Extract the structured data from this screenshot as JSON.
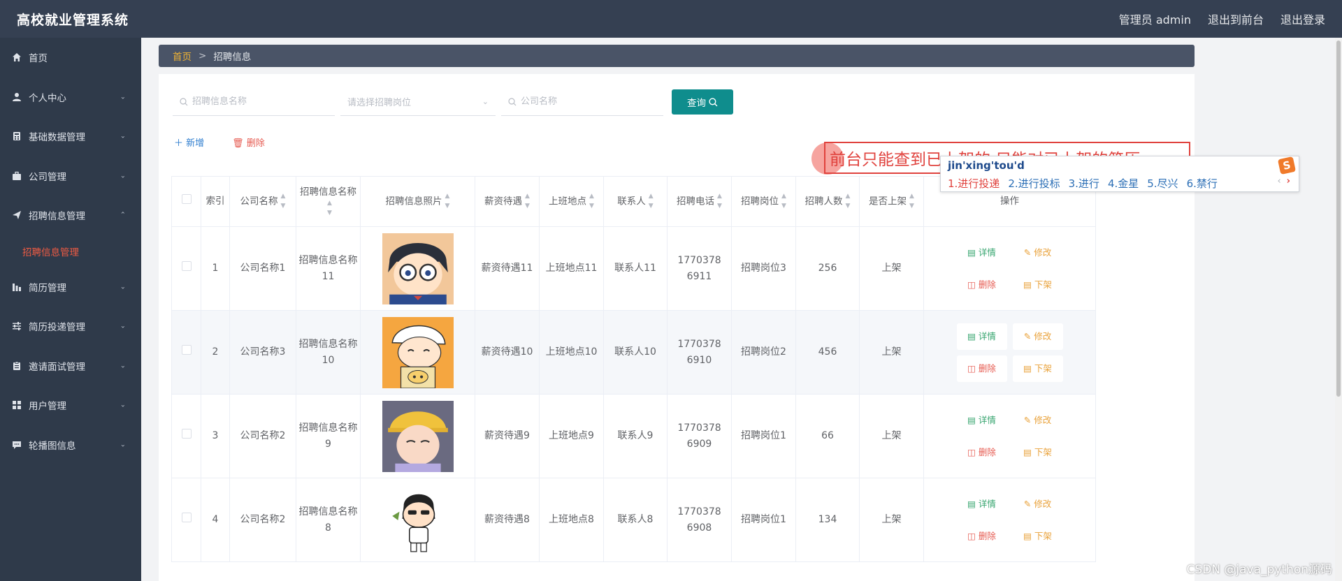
{
  "app": {
    "title": "高校就业管理系统",
    "user_label": "管理员 admin",
    "exit_front": "退出到前台",
    "logout": "退出登录"
  },
  "sidebar": {
    "items": [
      {
        "label": "首页",
        "icon": "home-icon"
      },
      {
        "label": "个人中心",
        "icon": "user-icon"
      },
      {
        "label": "基础数据管理",
        "icon": "calculator-icon"
      },
      {
        "label": "公司管理",
        "icon": "briefcase-icon"
      },
      {
        "label": "招聘信息管理",
        "icon": "send-icon"
      },
      {
        "label": "简历管理",
        "icon": "chart-icon"
      },
      {
        "label": "简历投递管理",
        "icon": "sliders-icon"
      },
      {
        "label": "邀请面试管理",
        "icon": "clipboard-icon"
      },
      {
        "label": "用户管理",
        "icon": "grid-icon"
      },
      {
        "label": "轮播图信息",
        "icon": "chat-icon"
      }
    ],
    "active_sub": "招聘信息管理"
  },
  "breadcrumb": {
    "home": "首页",
    "separator": ">",
    "current": "招聘信息"
  },
  "search": {
    "name_placeholder": "招聘信息名称",
    "post_placeholder": "请选择招聘岗位",
    "company_placeholder": "公司名称",
    "query_label": "查询"
  },
  "actions": {
    "add": "新增",
    "delete": "删除"
  },
  "note": "前台只能查到已上架的  只能对已上架的简历",
  "ime": {
    "composition": "jin'xing'tou'd",
    "candidates": [
      "1.进行投递",
      "2.进行投标",
      "3.进行",
      "4.金星",
      "5.尽兴",
      "6.禁行"
    ]
  },
  "table": {
    "headers": {
      "index": "索引",
      "company": "公司名称",
      "name": "招聘信息名称",
      "photo": "招聘信息照片",
      "salary": "薪资待遇",
      "location": "上班地点",
      "contact": "联系人",
      "phone": "招聘电话",
      "post": "招聘岗位",
      "count": "招聘人数",
      "listed": "是否上架",
      "ops": "操作"
    },
    "ops": {
      "detail": "详情",
      "edit": "修改",
      "delete": "删除",
      "down": "下架"
    },
    "rows": [
      {
        "index": "1",
        "company": "公司名称1",
        "name": "招聘信息名称11",
        "salary": "薪资待遇11",
        "location": "上班地点11",
        "contact": "联系人11",
        "phone": "17703786911",
        "post": "招聘岗位3",
        "count": "256",
        "listed": "上架"
      },
      {
        "index": "2",
        "company": "公司名称3",
        "name": "招聘信息名称10",
        "salary": "薪资待遇10",
        "location": "上班地点10",
        "contact": "联系人10",
        "phone": "17703786910",
        "post": "招聘岗位2",
        "count": "456",
        "listed": "上架"
      },
      {
        "index": "3",
        "company": "公司名称2",
        "name": "招聘信息名称9",
        "salary": "薪资待遇9",
        "location": "上班地点9",
        "contact": "联系人9",
        "phone": "17703786909",
        "post": "招聘岗位1",
        "count": "66",
        "listed": "上架"
      },
      {
        "index": "4",
        "company": "公司名称2",
        "name": "招聘信息名称8",
        "salary": "薪资待遇8",
        "location": "上班地点8",
        "contact": "联系人8",
        "phone": "17703786908",
        "post": "招聘岗位1",
        "count": "134",
        "listed": "上架"
      }
    ]
  },
  "watermark": "CSDN @java_python源码"
}
